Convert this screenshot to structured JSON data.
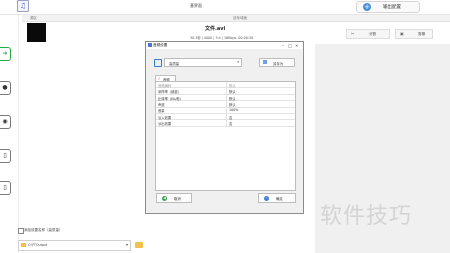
{
  "window": {
    "title": "基界面",
    "app_icon": "music-note-icon",
    "output_button": "输出配置",
    "output_icon": "plus-circle-icon",
    "accent": "#4a90d9"
  },
  "list_header": {
    "col_source": "源区",
    "col_target": "目标域面"
  },
  "file": {
    "name": "文件.avi",
    "meta": "30.3秒 | 4000 | 3:4 | 16Kbps. 00:00:30",
    "cut_label": "分割",
    "edit_label": "剪辑"
  },
  "sidebar_icons": [
    "green-arrow-icon",
    "disc-icon",
    "film-reel-icon",
    "document-icon",
    "document-icon"
  ],
  "dialog": {
    "title": "音频设置",
    "profile_value": "高质量",
    "save_as_label": "另存为",
    "tab_label": "音频",
    "table": {
      "header": {
        "key": "音频编码",
        "value": "默认"
      },
      "rows": [
        {
          "key": "采样率（赫兹）",
          "value": "默认"
        },
        {
          "key": "比特率（Kb/秒）",
          "value": "默认"
        },
        {
          "key": "声道",
          "value": "默认"
        },
        {
          "key": "音量",
          "value": "100%"
        },
        {
          "key": "淡入效果",
          "value": "否"
        },
        {
          "key": "淡出效果",
          "value": "否"
        }
      ]
    },
    "cancel_label": "取消",
    "ok_label": "确定"
  },
  "bottom": {
    "checkbox_label": "添加设置名称（高质量）",
    "path_value": "C:\\FFOutput"
  },
  "watermark": "软件技巧"
}
